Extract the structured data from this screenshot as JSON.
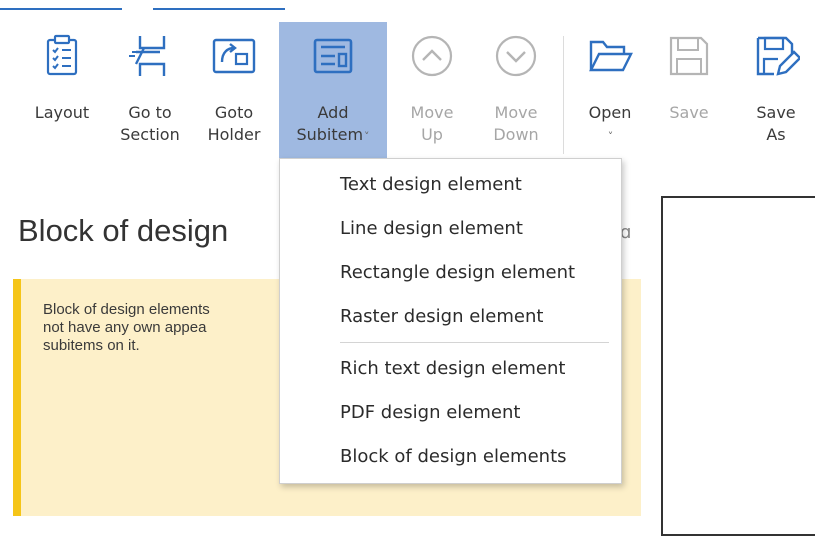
{
  "ribbon": {
    "buttons": [
      {
        "id": "layout",
        "label": "Layout",
        "icon": "clipboard-checklist-icon",
        "enabled": true
      },
      {
        "id": "go_to_section",
        "label": "Go to\nSection",
        "icon": "go-to-section-icon",
        "enabled": true
      },
      {
        "id": "goto_holder",
        "label": "Goto\nHolder",
        "icon": "goto-holder-icon",
        "enabled": true
      },
      {
        "id": "add_subitem",
        "label": "Add\nSubitem",
        "icon": "add-subitem-icon",
        "enabled": true,
        "active": true
      },
      {
        "id": "move_up",
        "label": "Move\nUp",
        "icon": "arrow-up-circle-icon",
        "enabled": false
      },
      {
        "id": "move_down",
        "label": "Move\nDown",
        "icon": "arrow-down-circle-icon",
        "enabled": false
      },
      {
        "id": "open",
        "label": "Open",
        "icon": "folder-open-icon",
        "enabled": true
      },
      {
        "id": "save",
        "label": "Save",
        "icon": "save-icon",
        "enabled": false
      },
      {
        "id": "save_as",
        "label": "Save\nAs",
        "icon": "save-as-icon",
        "enabled": true
      }
    ],
    "active_color": "#9fb9e1",
    "icon_color": "#2e6fc0"
  },
  "main": {
    "title": "Block of design",
    "note": "Block of design elements\nnot have any own appea\nsubitems on it.",
    "note_bg": "#fdf0c9",
    "note_accent": "#f5c518"
  },
  "dropdown": {
    "items": [
      "Text design element",
      "Line design element",
      "Rectangle design element",
      "Raster design element",
      "Rich text design element",
      "PDF design element",
      "Block of design elements"
    ]
  }
}
